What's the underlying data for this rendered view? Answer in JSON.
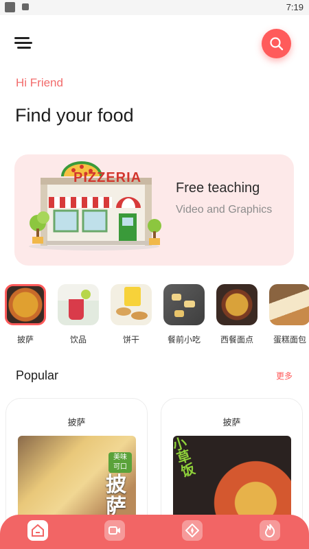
{
  "status_bar": {
    "time": "7:19"
  },
  "header": {
    "greeting": "Hi Friend",
    "title": "Find your food"
  },
  "banner": {
    "title": "Free teaching",
    "subtitle": "Video and Graphics",
    "logo_text": "PIZZERIA"
  },
  "categories": [
    {
      "label": "披萨",
      "icon": "pizza-thumb",
      "selected": true
    },
    {
      "label": "饮品",
      "icon": "drink-thumb"
    },
    {
      "label": "饼干",
      "icon": "cookie-thumb"
    },
    {
      "label": "餐前小吃",
      "icon": "snack-thumb"
    },
    {
      "label": "西餐面点",
      "icon": "western-thumb"
    },
    {
      "label": "蛋糕面包",
      "icon": "bread-thumb"
    }
  ],
  "popular": {
    "title": "Popular",
    "more_label": "更多",
    "cards": [
      {
        "title": "披萨",
        "image_text": [
          "美味",
          "可口",
          "披",
          "萨"
        ]
      },
      {
        "title": "披萨",
        "image_text": [
          "小",
          "草",
          "饭"
        ]
      }
    ]
  },
  "bottom_nav": [
    {
      "name": "home",
      "active": true
    },
    {
      "name": "video",
      "active": false
    },
    {
      "name": "discover",
      "active": false
    },
    {
      "name": "hot",
      "active": false
    }
  ],
  "colors": {
    "accent": "#ff5b5b",
    "banner_bg": "#fde9e9",
    "nav_bg": "#f26565"
  }
}
